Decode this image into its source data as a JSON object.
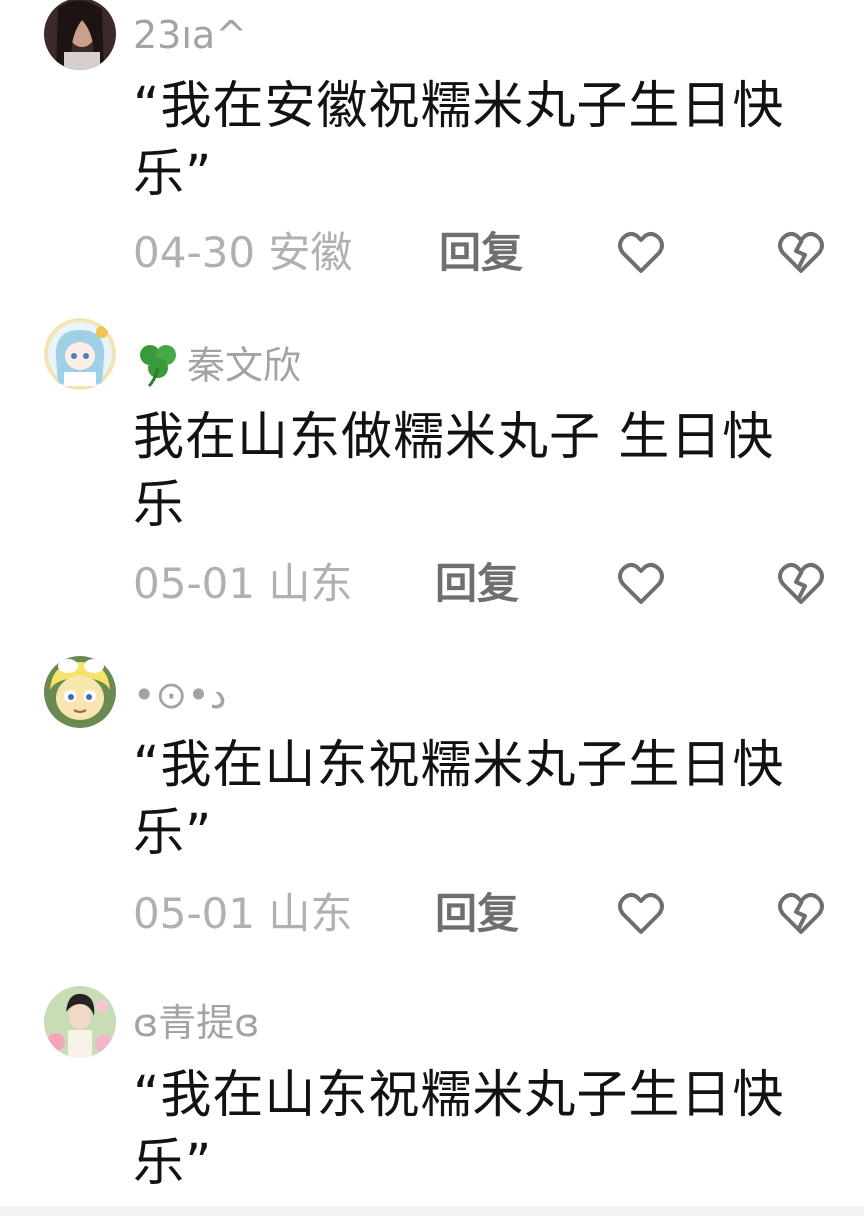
{
  "comments": [
    {
      "username": "23ıa^",
      "text": "“我在安徽祝糯米丸子生日快乐”",
      "time": "04-30 安徽",
      "reply_label": "回复",
      "avatar_icon": "avatar-woman-dark-hair"
    },
    {
      "username": "☘秦文欣",
      "username_prefix_icon": "clover-icon",
      "username_text": "秦文欣",
      "text": "我在山东做糯米丸子 生日快乐",
      "time": "05-01 山东",
      "reply_label": "回复",
      "avatar_icon": "avatar-anime-girl-blue-hair"
    },
    {
      "username": "•⊙•د",
      "text": "“我在山东祝糯米丸子生日快乐”",
      "time": "05-01 山东",
      "reply_label": "回复",
      "avatar_icon": "avatar-cartoon-blonde"
    },
    {
      "username": "ɞ青提ɞ",
      "text": "“我在山东祝糯米丸子生日快乐”",
      "avatar_icon": "avatar-woman-flowers"
    }
  ],
  "icons": {
    "like": "heart-outline-icon",
    "dislike": "broken-heart-icon"
  },
  "colors": {
    "text_primary": "#121212",
    "text_secondary": "#a3a3a3",
    "reply_label": "#6f6f6f",
    "icon_stroke": "#6f6f6f"
  }
}
